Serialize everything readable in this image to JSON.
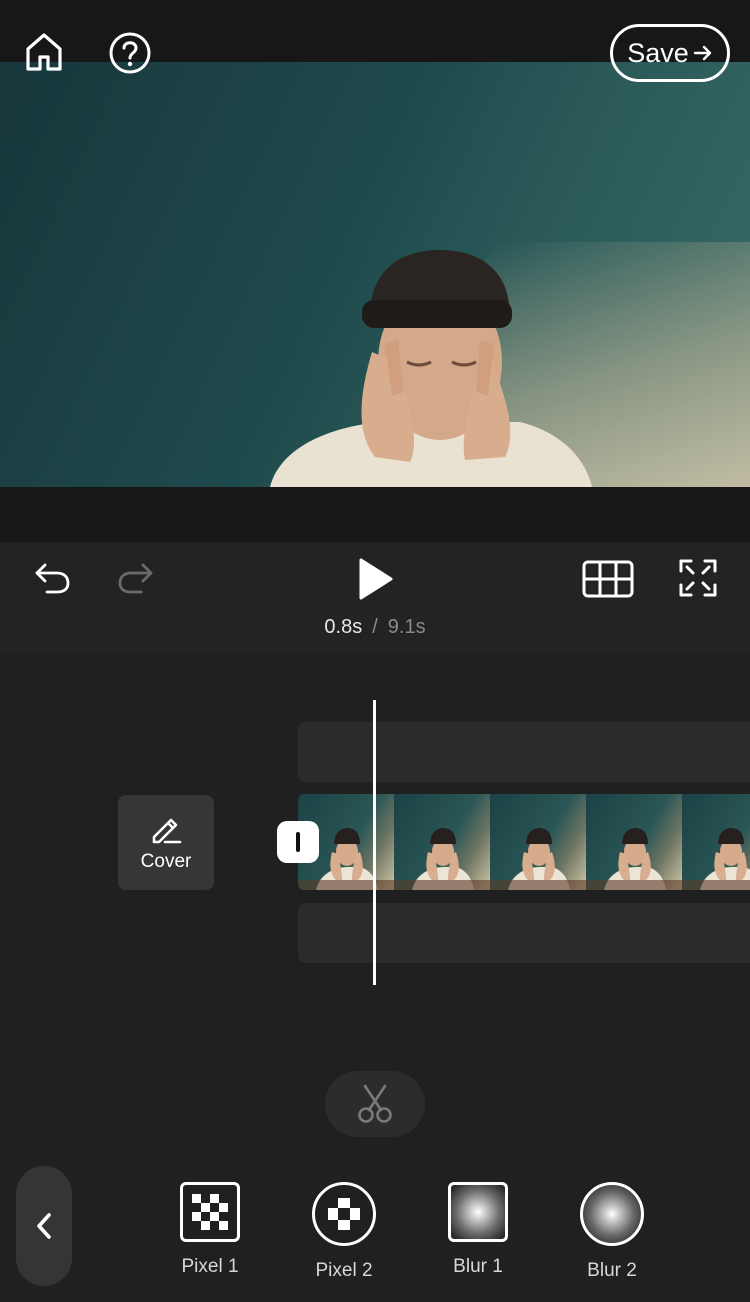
{
  "header": {
    "home_icon": "home-icon",
    "help_icon": "help-icon",
    "save_label": "Save",
    "save_icon": "arrow-right-icon"
  },
  "player": {
    "current_time": "0.8s",
    "separator": "/",
    "total_time": "9.1s",
    "icons": [
      "undo-icon",
      "redo-icon",
      "play-icon",
      "grid-icon",
      "fullscreen-icon"
    ]
  },
  "timeline": {
    "cover_label": "Cover",
    "cover_icon": "pencil-icon",
    "thumbnail_count": 5
  },
  "tools": {
    "scissors_icon": "scissors-icon",
    "back_icon": "chevron-left-icon"
  },
  "effects": [
    {
      "label": "Pixel 1",
      "icon": "pixel-grid-square-icon"
    },
    {
      "label": "Pixel 2",
      "icon": "pixel-grid-circle-icon"
    },
    {
      "label": "Blur 1",
      "icon": "blur-square-icon"
    },
    {
      "label": "Blur 2",
      "icon": "blur-circle-icon"
    }
  ]
}
